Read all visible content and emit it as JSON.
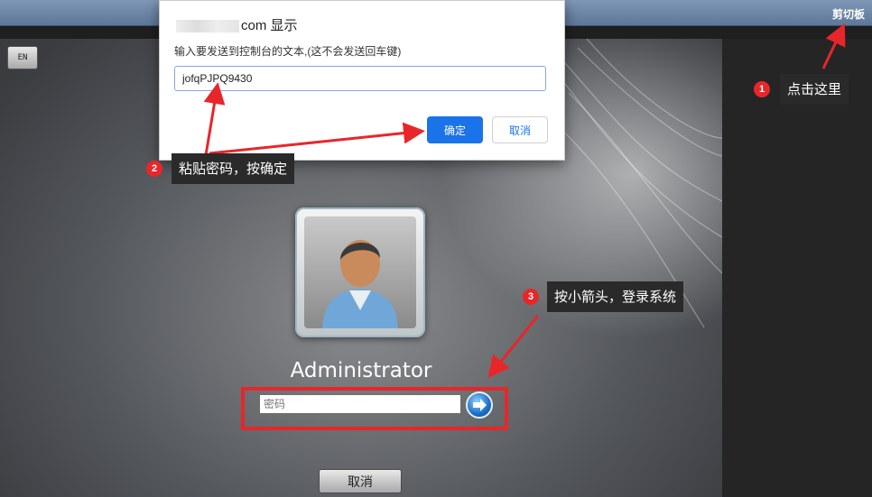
{
  "topbar": {
    "clipboard_label": "剪切板"
  },
  "lang_button": "EN",
  "dialog": {
    "title_suffix": "com 显示",
    "message": "输入要发送到控制台的文本,(这不会发送回车键)",
    "input_value": "jofqPJPQ9430",
    "ok_label": "确定",
    "cancel_label": "取消"
  },
  "login": {
    "user_name": "Administrator",
    "password_placeholder": "密码",
    "cancel_label": "取消"
  },
  "annotations": [
    {
      "number": "1",
      "text": "点击这里"
    },
    {
      "number": "2",
      "text": "粘贴密码，按确定"
    },
    {
      "number": "3",
      "text": "按小箭头，登录系统"
    }
  ],
  "colors": {
    "accent": "#1a73e8",
    "annotation_red": "#e8262a"
  }
}
